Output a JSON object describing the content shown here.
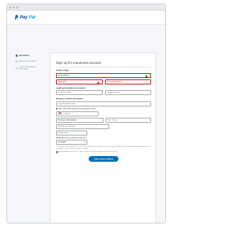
{
  "brand": {
    "logo_pay": "Pay",
    "logo_pal": "Pal"
  },
  "steps": [
    {
      "label": "Get started",
      "active": true
    },
    {
      "label": "Business information",
      "active": false
    },
    {
      "label": "Legal representative information",
      "active": false
    }
  ],
  "form": {
    "title": "Sign up for a Business account",
    "login": {
      "heading": "Create a login",
      "email_placeholder": "Email address",
      "password_placeholder": "Password",
      "reenter_placeholder": "Re-enter password"
    },
    "legal_rep": {
      "heading": "Legal representative information",
      "first_name_placeholder": "Legal first name",
      "last_name_placeholder": "Legal last name"
    },
    "business_contact": {
      "heading": "Business contact information",
      "business_name_placeholder": "Legal business name",
      "phone_note": "This is the name you want your customers to see",
      "phone_placeholder": "Phone",
      "province_placeholder": "Province / Municipality",
      "city_placeholder": "City / County",
      "address_placeholder": "Address (no PO box)",
      "postal_placeholder": "Postal code"
    },
    "currency": {
      "question": "What will be your primary currency?",
      "selected": "US Dollar"
    },
    "legal_text": "Cross-border currency: PayPal Pte. Ltd., the issuer of PayPal's stored value facility, does not require the approval of the Monetary Authority of Singapore. Users are advised to read the terms and conditions carefully.",
    "agree_text": "By clicking Agree and Continue, I agree to receive the PayPal User Agreement and Privacy Policy.",
    "submit_label": "Agree and Continue"
  }
}
